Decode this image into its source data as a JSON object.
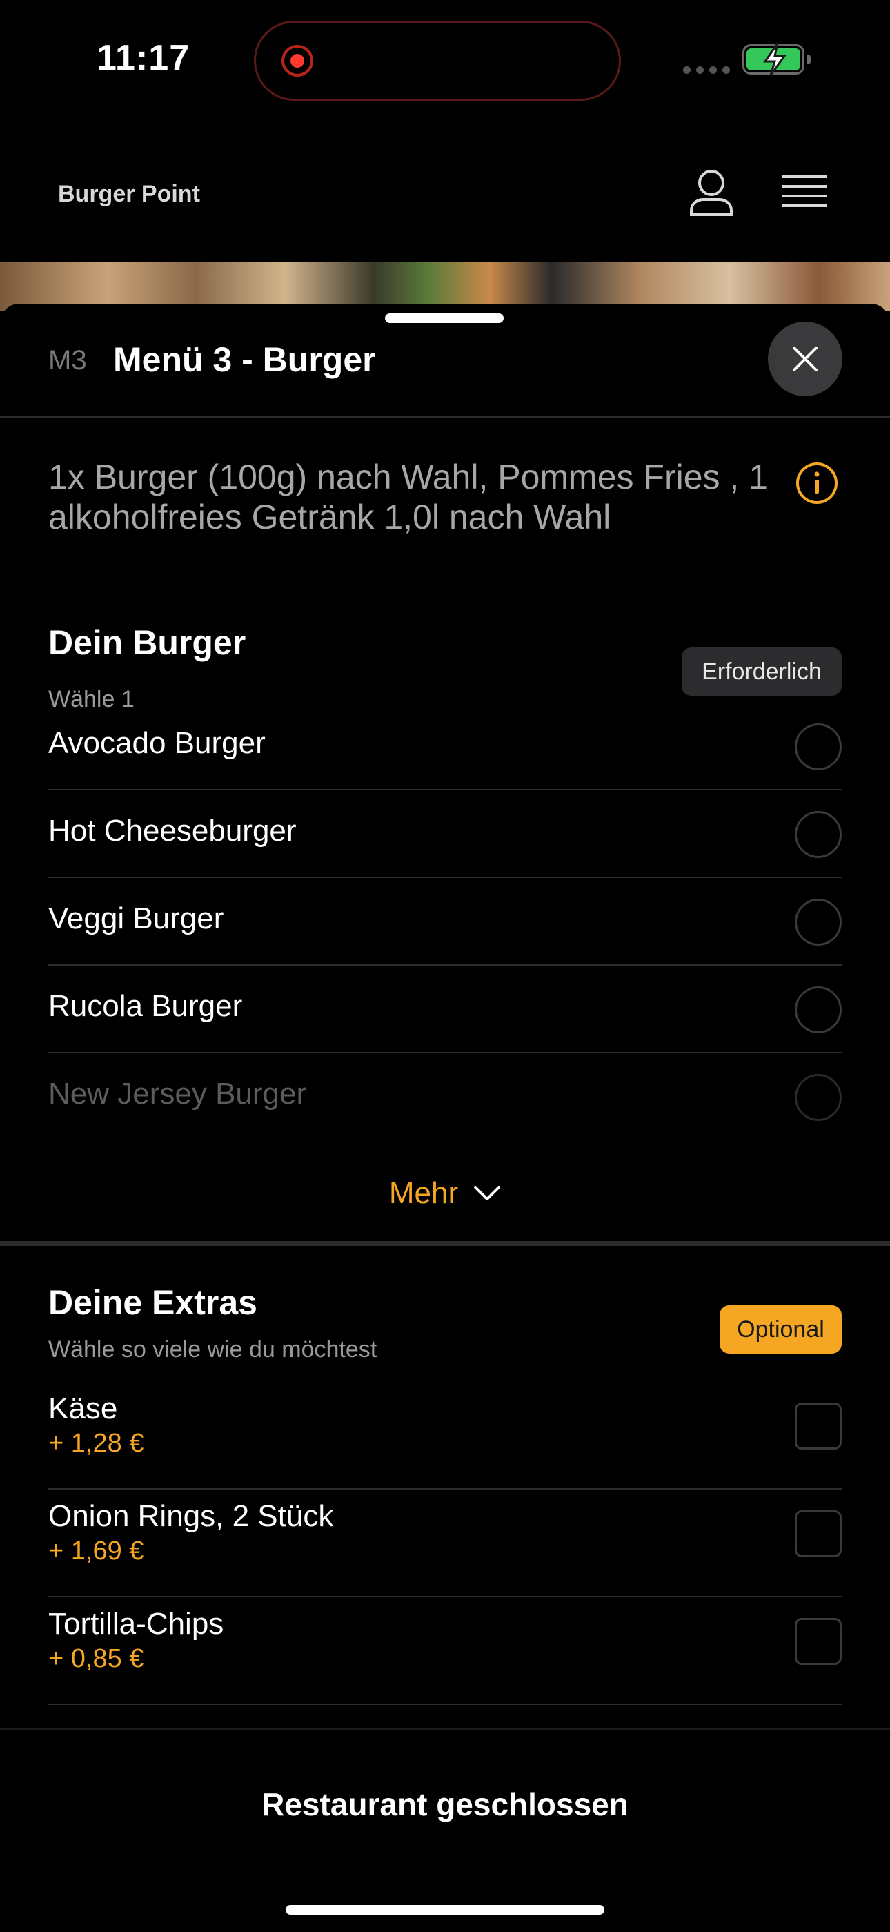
{
  "status_bar": {
    "time": "11:17"
  },
  "header": {
    "brand": "Burger Point"
  },
  "item": {
    "code": "M3",
    "title": "Menü 3 - Burger",
    "description": "1x Burger (100g) nach Wahl, Pommes Fries , 1 alkoholfreies Getränk 1,0l nach Wahl"
  },
  "burger_section": {
    "title": "Dein Burger",
    "subtitle": "Wähle 1",
    "badge": "Erforderlich",
    "options": [
      "Avocado Burger",
      "Hot Cheeseburger",
      "Veggi Burger",
      "Rucola Burger",
      "New Jersey Burger"
    ],
    "more_label": "Mehr"
  },
  "extras_section": {
    "title": "Deine Extras",
    "subtitle": "Wähle so viele wie du möchtest",
    "badge": "Optional",
    "items": [
      {
        "name": "Käse",
        "price": "+ 1,28 €"
      },
      {
        "name": "Onion Rings, 2 Stück",
        "price": "+ 1,69 €"
      },
      {
        "name": "Tortilla-Chips",
        "price": "+ 0,85 €"
      }
    ]
  },
  "footer": {
    "status": "Restaurant geschlossen"
  },
  "colors": {
    "accent": "#f5a623",
    "background": "#000000",
    "surface": "#2c2c2e"
  }
}
